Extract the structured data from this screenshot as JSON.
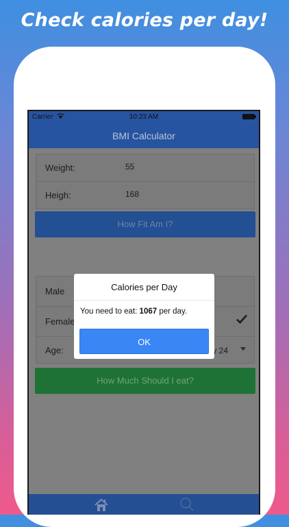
{
  "headline": "Check calories per day!",
  "status": {
    "carrier": "Carrier",
    "time": "10:23 AM"
  },
  "nav": {
    "title": "BMI Calculator"
  },
  "measure": {
    "weight_label": "Weight:",
    "weight_value": "55",
    "height_label": "Heigh:",
    "height_value": "168"
  },
  "fit_button": "How Fit Am I?",
  "profile": {
    "male_label": "Male",
    "female_label": "Female",
    "age_label": "Age:",
    "age_value": "y 24"
  },
  "eat_button": "How Much Should I eat?",
  "dialog": {
    "title": "Calories per Day",
    "msg_prefix": "You need to eat: ",
    "calories": "1067",
    "msg_suffix": " per day.",
    "ok": "OK"
  },
  "tabs": {
    "home_icon": "home-icon",
    "search_icon": "search-icon"
  },
  "colors": {
    "nav": "#2754a0",
    "ok": "#3a86f5",
    "eat": "#1f7235"
  }
}
